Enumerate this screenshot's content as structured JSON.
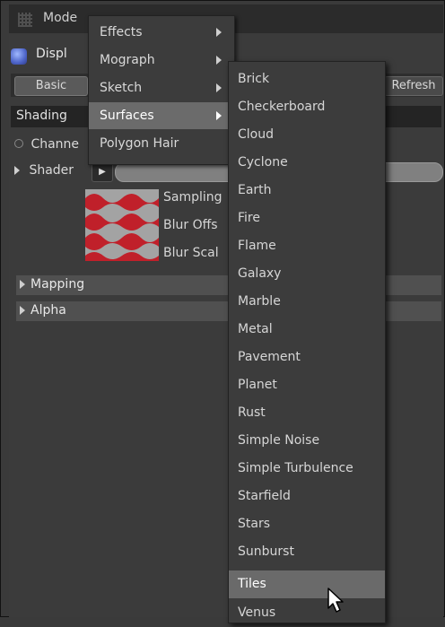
{
  "window": {
    "title": "Mode",
    "disp_label": "Displ",
    "tab_basic": "Basic",
    "refresh_button": "Refresh"
  },
  "material_panel": {
    "section": "Shading",
    "channel_label": "Channe",
    "shader_label": "Shader",
    "params": [
      "Sampling",
      "Blur Offs",
      "Blur Scal"
    ],
    "mapping": "Mapping",
    "alpha": "Alpha"
  },
  "menu_main": {
    "items": [
      {
        "label": "Effects",
        "has_sub": true,
        "highlighted": false
      },
      {
        "label": "Mograph",
        "has_sub": true,
        "highlighted": false
      },
      {
        "label": "Sketch",
        "has_sub": true,
        "highlighted": false
      },
      {
        "label": "Surfaces",
        "has_sub": true,
        "highlighted": true
      },
      {
        "label": "Polygon Hair",
        "has_sub": false,
        "highlighted": false
      }
    ]
  },
  "menu_surfaces": {
    "items": [
      "Brick",
      "Checkerboard",
      "Cloud",
      "Cyclone",
      "Earth",
      "Fire",
      "Flame",
      "Galaxy",
      "Marble",
      "Metal",
      "Pavement",
      "Planet",
      "Rust",
      "Simple Noise",
      "Simple Turbulence",
      "Starfield",
      "Stars",
      "Sunburst",
      "Tiles",
      "Venus"
    ],
    "highlighted": "Tiles"
  },
  "colors": {
    "panel_bg": "#3a3a3a",
    "menu_bg": "#3c3c3c",
    "menu_highlight": "#6b6b6b",
    "swatch_red": "#c0202a"
  }
}
